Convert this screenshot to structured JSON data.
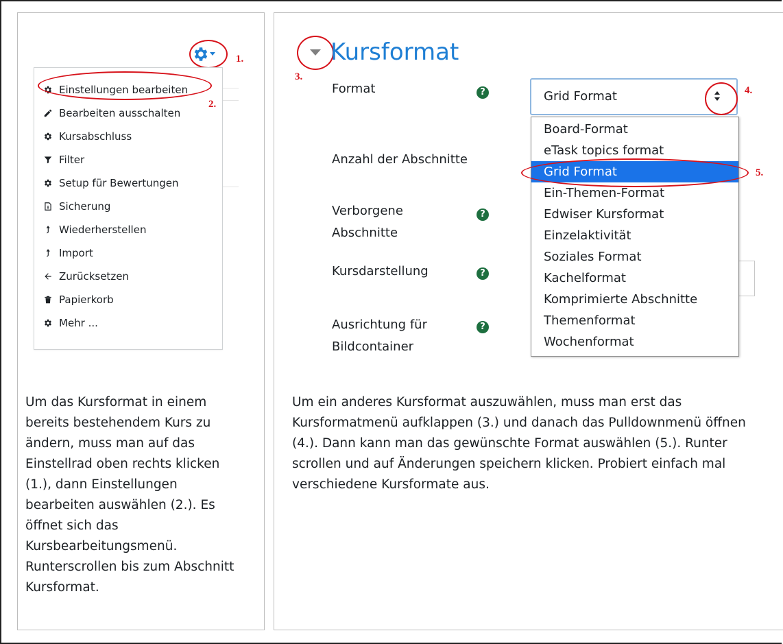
{
  "menu": {
    "items": [
      {
        "label": "Einstellungen bearbeiten",
        "icon": "gear-icon"
      },
      {
        "label": "Bearbeiten ausschalten",
        "icon": "pencil-icon"
      },
      {
        "label": "Kursabschluss",
        "icon": "gear-icon"
      },
      {
        "label": "Filter",
        "icon": "filter-icon"
      },
      {
        "label": "Setup für Bewertungen",
        "icon": "gear-icon"
      },
      {
        "label": "Sicherung",
        "icon": "file-icon"
      },
      {
        "label": "Wiederherstellen",
        "icon": "upload-icon"
      },
      {
        "label": "Import",
        "icon": "upload-icon"
      },
      {
        "label": "Zurücksetzen",
        "icon": "arrow-left-icon"
      },
      {
        "label": "Papierkorb",
        "icon": "trash-icon"
      },
      {
        "label": "Mehr ...",
        "icon": "gear-icon"
      }
    ]
  },
  "steps": {
    "s1": "1.",
    "s2": "2.",
    "s3": "3.",
    "s4": "4.",
    "s5": "5."
  },
  "left_text": "Um das Kursformat in einem bereits bestehendem Kurs zu ändern, muss man auf das Einstellrad oben rechts klicken (1.), dann Einstellungen bearbeiten auswählen (2.). Es öffnet sich das Kursbearbeitungsmenü. Runterscrollen bis zum Abschnitt Kursformat.",
  "section": {
    "title": "Kursformat"
  },
  "fields": {
    "format": "Format",
    "anzahl": "Anzahl der Abschnitte",
    "verborgene_1": "Verborgene",
    "verborgene_2": "Abschnitte",
    "kursdarstellung": "Kursdarstellung",
    "ausrichtung_1": "Ausrichtung für",
    "ausrichtung_2": "Bildcontainer",
    "help": "?"
  },
  "select": {
    "value": "Grid Format",
    "options": [
      "Board-Format",
      "eTask topics format",
      "Grid Format",
      "Ein-Themen-Format",
      "Edwiser Kursformat",
      "Einzelaktivität",
      "Soziales Format",
      "Kachelformat",
      "Komprimierte Abschnitte",
      "Themenformat",
      "Wochenformat"
    ],
    "selected_index": 2
  },
  "right_text": "Um ein anderes Kursformat auszuwählen, muss man erst das Kursformatmenü aufklappen (3.) und danach das Pulldownmenü öffnen (4.). Dann kann man das gewünschte Format auswählen (5.). Runter scrollen und auf Änderungen speichern klicken. Probiert einfach mal verschiedene Kursformate aus.",
  "colors": {
    "accent": "#1f7fd4",
    "annotation": "#d7131b",
    "help": "#1d6f3f",
    "selected": "#1a73e8"
  }
}
